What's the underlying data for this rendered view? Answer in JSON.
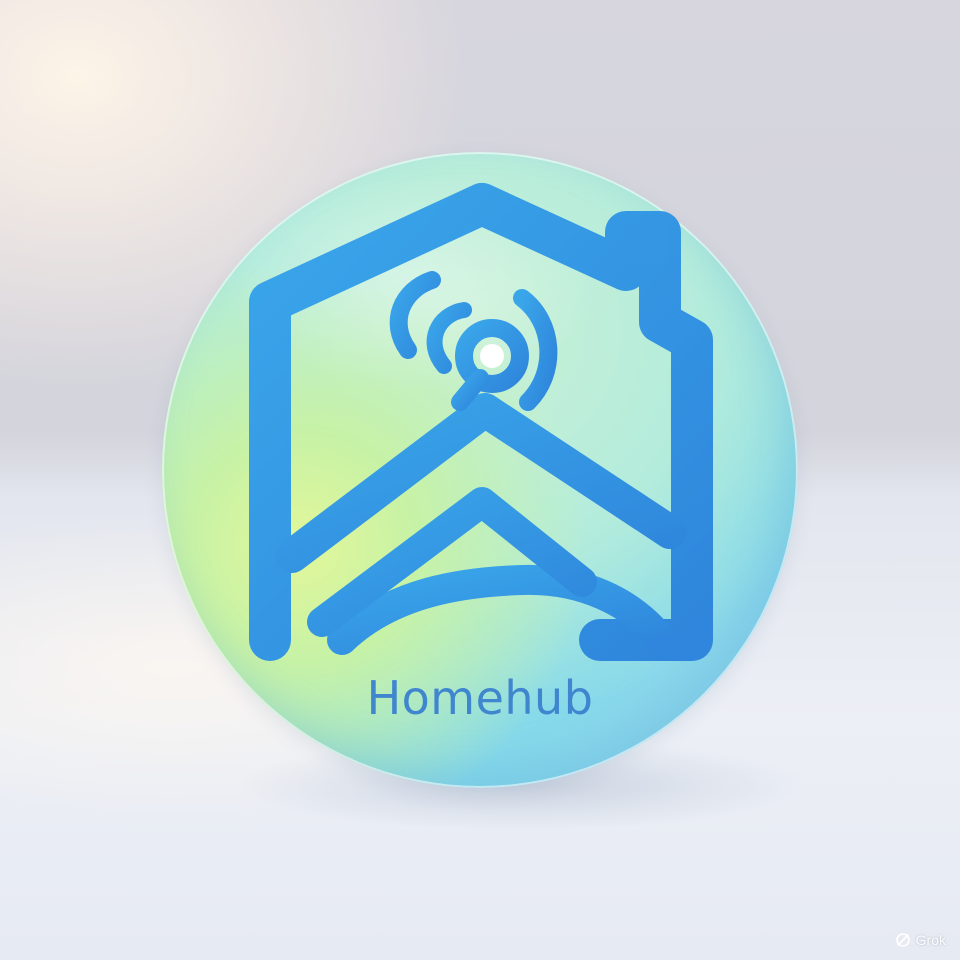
{
  "brand": {
    "name": "Homehub"
  },
  "colors": {
    "logo_blue": "#2f8fe0",
    "logo_blue_light": "#3aa6ea",
    "badge_green": "#c7f2a6",
    "badge_cyan": "#8fdcea",
    "text_blue": "#3f86cf"
  },
  "icons": {
    "logo": "house-with-wifi-signal-icon",
    "watermark": "grok-logo-icon"
  },
  "watermark": {
    "label": "Grok"
  }
}
